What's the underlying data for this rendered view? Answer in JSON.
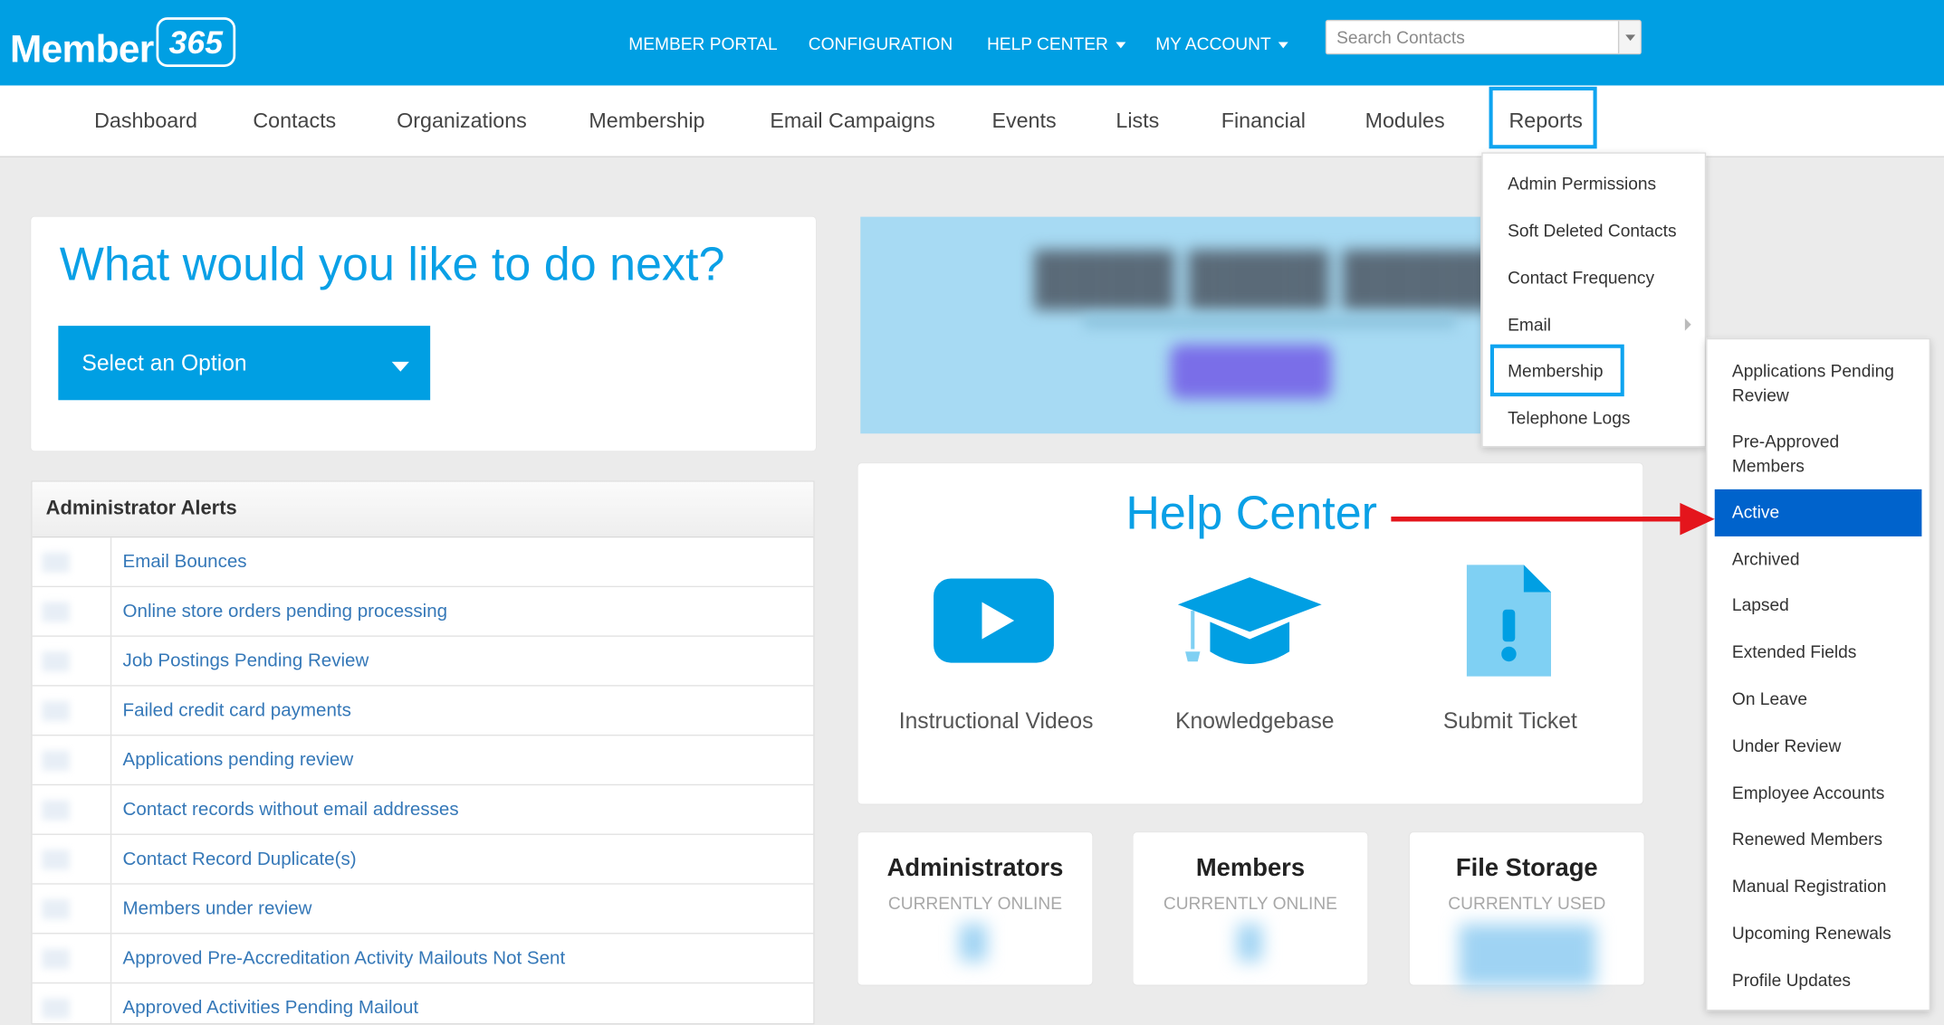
{
  "brand": {
    "name": "Member",
    "badge": "365"
  },
  "topnav": {
    "member_portal": "MEMBER PORTAL",
    "configuration": "CONFIGURATION",
    "help_center": "HELP CENTER",
    "my_account": "MY ACCOUNT"
  },
  "search": {
    "placeholder": "Search Contacts",
    "value": ""
  },
  "mainnav": [
    "Dashboard",
    "Contacts",
    "Organizations",
    "Membership",
    "Email Campaigns",
    "Events",
    "Lists",
    "Financial",
    "Modules",
    "Reports"
  ],
  "next": {
    "title": "What would you like to do next?",
    "select_label": "Select an Option"
  },
  "alerts": {
    "title": "Administrator Alerts",
    "items": [
      "Email Bounces",
      "Online store orders pending processing",
      "Job Postings Pending Review",
      "Failed credit card payments",
      "Applications pending review",
      "Contact records without email addresses",
      "Contact Record Duplicate(s)",
      "Members under review",
      "Approved Pre-Accreditation Activity Mailouts Not Sent",
      "Approved Activities Pending Mailout"
    ]
  },
  "help": {
    "title": "Help Center",
    "items": [
      "Instructional Videos",
      "Knowledgebase",
      "Submit Ticket"
    ]
  },
  "stats": [
    {
      "title": "Administrators",
      "subtitle": "CURRENTLY ONLINE"
    },
    {
      "title": "Members",
      "subtitle": "CURRENTLY ONLINE"
    },
    {
      "title": "File Storage",
      "subtitle": "CURRENTLY USED"
    }
  ],
  "reports_menu": [
    "Admin Permissions",
    "Soft Deleted Contacts",
    "Contact Frequency",
    "Email",
    "Membership",
    "Telephone Logs"
  ],
  "membership_submenu": [
    "Applications Pending Review",
    "Pre-Approved Members",
    "Active",
    "Archived",
    "Lapsed",
    "Extended Fields",
    "On Leave",
    "Under Review",
    "Employee Accounts",
    "Renewed Members",
    "Manual Registration",
    "Upcoming Renewals",
    "Profile Updates"
  ],
  "colors": {
    "brand_blue": "#009fe3",
    "active_item": "#0063cc",
    "highlight_box": "#0ea4f0",
    "annotation_arrow": "#e4151c"
  }
}
